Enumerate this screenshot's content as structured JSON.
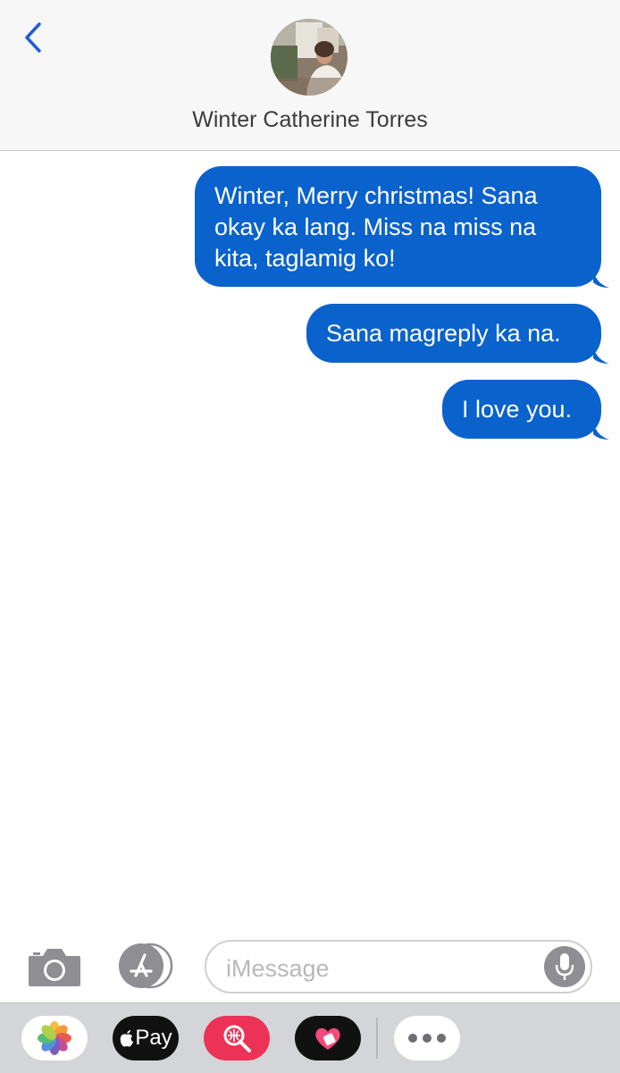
{
  "header": {
    "back_icon": "chevron-left-icon",
    "contact_name": "Winter Catherine Torres",
    "accent_color": "#1f5ed8"
  },
  "messages": [
    {
      "lines": [
        "Winter, Merry christmas! Sana",
        "okay ka lang. Miss na miss na",
        "kita, taglamig ko!"
      ]
    },
    {
      "lines": [
        "Sana magreply ka na."
      ]
    },
    {
      "lines": [
        "I love you."
      ]
    }
  ],
  "bubble_color": "#0a62cc",
  "compose": {
    "camera_icon": "camera-icon",
    "appstore_icon": "app-store-icon",
    "placeholder": "iMessage",
    "mic_icon": "microphone-icon"
  },
  "app_drawer": {
    "pay_label": "Pay",
    "apps": [
      "photos-icon",
      "apple-pay-icon",
      "image-search-icon",
      "digital-touch-icon",
      "more-icon"
    ]
  }
}
